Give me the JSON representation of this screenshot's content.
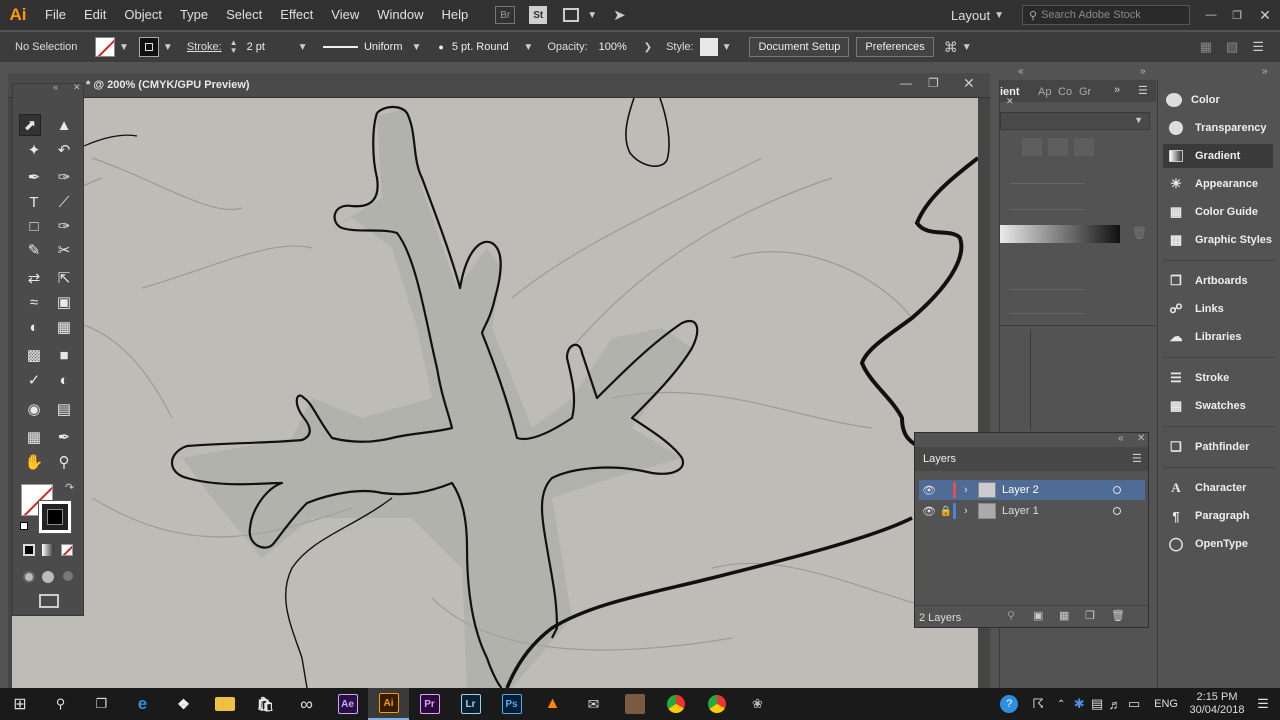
{
  "app": {
    "logo": "Ai",
    "brand_color": "#ff9a00"
  },
  "menu": [
    "File",
    "Edit",
    "Object",
    "Type",
    "Select",
    "Effect",
    "View",
    "Window",
    "Help"
  ],
  "top_right": {
    "workspace": "Layout",
    "search_placeholder": "Search Adobe Stock",
    "br_label": "Br",
    "st_label": "St"
  },
  "control": {
    "selection": "No Selection",
    "stroke_label": "Stroke:",
    "stroke_weight": "2 pt",
    "profile": "Uniform",
    "brush": "5 pt. Round",
    "opacity_label": "Opacity:",
    "opacity": "100%",
    "style_label": "Style:",
    "doc_setup": "Document Setup",
    "preferences": "Preferences"
  },
  "document": {
    "tab_title": "* @ 200% (CMYK/GPU Preview)"
  },
  "mid_panel": {
    "tab1": "ient",
    "tab2": "Ap",
    "tab3": "Co",
    "tab4": "Gr"
  },
  "panels": [
    {
      "label": "Color",
      "icon": "color-icon"
    },
    {
      "label": "Transparency",
      "icon": "transparency-icon"
    },
    {
      "label": "Gradient",
      "icon": "gradient-icon",
      "selected": true
    },
    {
      "label": "Appearance",
      "icon": "appearance-icon"
    },
    {
      "label": "Color Guide",
      "icon": "color-guide-icon"
    },
    {
      "label": "Graphic Styles",
      "icon": "graphic-styles-icon"
    },
    {
      "label": "Artboards",
      "icon": "artboards-icon"
    },
    {
      "label": "Links",
      "icon": "links-icon"
    },
    {
      "label": "Libraries",
      "icon": "libraries-icon"
    },
    {
      "label": "Stroke",
      "icon": "stroke-icon"
    },
    {
      "label": "Swatches",
      "icon": "swatches-icon"
    },
    {
      "label": "Pathfinder",
      "icon": "pathfinder-icon"
    },
    {
      "label": "Character",
      "icon": "character-icon"
    },
    {
      "label": "Paragraph",
      "icon": "paragraph-icon"
    },
    {
      "label": "OpenType",
      "icon": "opentype-icon"
    }
  ],
  "layers": {
    "title": "Layers",
    "items": [
      {
        "name": "Layer 2",
        "color": "#e05050",
        "selected": true
      },
      {
        "name": "Layer 1",
        "color": "#4f7fe0",
        "selected": false
      }
    ],
    "count": "2 Layers"
  },
  "taskbar": {
    "apps": [
      "Ae",
      "Ai",
      "Pr",
      "Lr",
      "Ps"
    ],
    "lang": "ENG",
    "time": "2:15 PM",
    "date": "30/04/2018"
  }
}
